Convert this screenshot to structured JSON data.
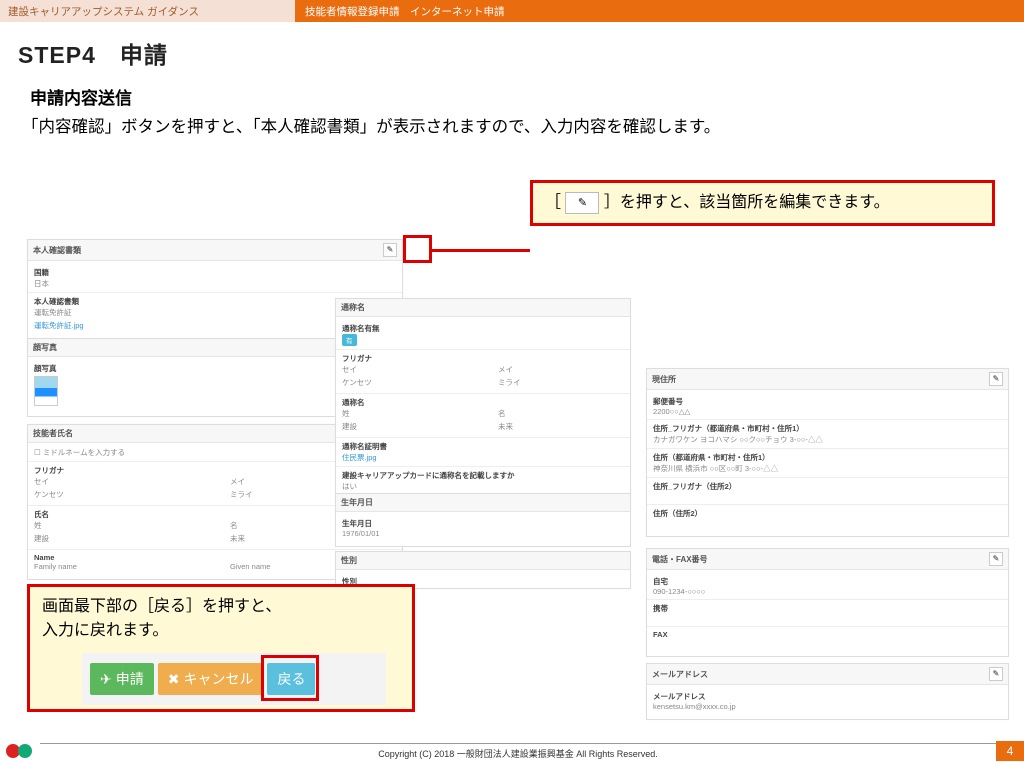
{
  "topbar": {
    "left": "建設キャリアアップシステム ガイダンス",
    "right": "技能者情報登録申請　インターネット申請"
  },
  "titles": {
    "step": "STEP4　申請",
    "sub": "申請内容送信",
    "desc": "「内容確認」ボタンを押すと、「本人確認書類」が表示されますので、入力内容を確認します。"
  },
  "callout_top": {
    "prefix": "［",
    "suffix": "］を押すと、該当箇所を編集できます。",
    "icon": "✎"
  },
  "callout_bottom": {
    "line1": "画面最下部の［戻る］を押すと、",
    "line2": "入力に戻れます。"
  },
  "buttons": {
    "apply": "申請",
    "cancel": "キャンセル",
    "back": "戻る"
  },
  "panel_a": {
    "title": "本人確認書類",
    "s1": {
      "lbl": "国籍",
      "val": "日本"
    },
    "s2": {
      "lbl": "本人確認書類",
      "val1": "運転免許証",
      "link": "運転免許証.jpg"
    }
  },
  "panel_b": {
    "title": "顔写真",
    "lbl": "顔写真"
  },
  "panel_c": {
    "title": "技能者氏名",
    "mid": "ミドルネームを入力する",
    "furi": "フリガナ",
    "sei_l": "セイ",
    "sei_v": "ケンセツ",
    "mei_l": "メイ",
    "mei_v": "ミライ",
    "name_l": "氏名",
    "sei2": "姓",
    "sei2v": "建設",
    "mei2": "名",
    "mei2v": "未来",
    "name_en": "Name",
    "fn": "Family name",
    "gn": "Given name"
  },
  "panel_d": {
    "title": "通称名",
    "flag_l": "通称名有無",
    "flag_v": "有",
    "furi": "フリガナ",
    "sei_l": "セイ",
    "sei_v": "ケンセツ",
    "mei_l": "メイ",
    "mei_v": "ミライ",
    "name": "通称名",
    "sei2": "姓",
    "sei2v": "建設",
    "mei2": "名",
    "mei2v": "未来",
    "doc_l": "通称名証明書",
    "doc_link": "住民票.jpg",
    "q": "建設キャリアアップカードに通称名を記載しますか",
    "a": "はい"
  },
  "panel_e": {
    "title": "生年月日",
    "lbl": "生年月日",
    "val": "1976/01/01"
  },
  "panel_f": {
    "title": "性別",
    "lbl": "性別"
  },
  "panel_g": {
    "title": "現住所",
    "zip_l": "郵便番号",
    "zip_v": "2200○○△△",
    "fur_l": "住所_フリガナ（都道府県・市町村・住所1）",
    "fur_v": "カナガワケン ヨコハマシ ○○ク○○チョウ 3-○○-△△",
    "adr_l": "住所（都道府県・市町村・住所1）",
    "adr_v": "神奈川県 横浜市 ○○区○○町 3-○○-△△",
    "f2_l": "住所_フリガナ（住所2）",
    "a2_l": "住所（住所2）"
  },
  "panel_h": {
    "title": "電話・FAX番号",
    "tel_l": "自宅",
    "tel_v": "090-1234-○○○○",
    "mob_l": "携帯",
    "fax_l": "FAX"
  },
  "panel_i": {
    "title": "メールアドレス",
    "lbl": "メールアドレス",
    "val": "kensetsu.km@xxxx.co.jp"
  },
  "footer": {
    "copy": "Copyright (C) 2018 一般財団法人建設業振興基金 All Rights Reserved.",
    "page": "4"
  }
}
